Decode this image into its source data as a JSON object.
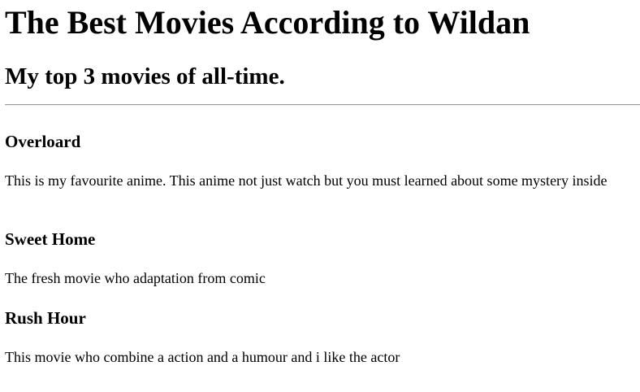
{
  "page": {
    "title": "The Best Movies According to Wildan",
    "subtitle": "My top 3 movies of all-time."
  },
  "movies": [
    {
      "title": "Overloard",
      "description": "This is my favourite anime. This anime not just watch but you must learned about some mystery inside"
    },
    {
      "title": "Sweet Home",
      "description": "The fresh movie who adaptation from comic"
    },
    {
      "title": "Rush Hour",
      "description": "This movie who combine a action and a humour and i like the actor"
    }
  ]
}
